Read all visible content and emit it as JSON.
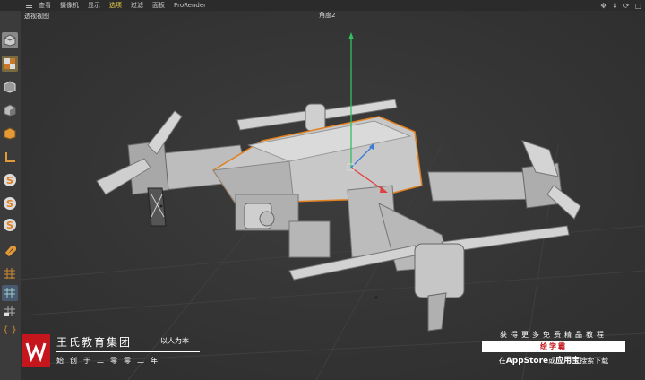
{
  "menubar": {
    "items": [
      {
        "label": "查看",
        "active": false
      },
      {
        "label": "摄像机",
        "active": false
      },
      {
        "label": "显示",
        "active": false
      },
      {
        "label": "选项",
        "active": true
      },
      {
        "label": "过滤",
        "active": false
      },
      {
        "label": "面板",
        "active": false
      },
      {
        "label": "ProRender",
        "active": false
      }
    ],
    "nav_icons": [
      "move-icon",
      "zoom-icon",
      "rotate-icon",
      "maximize-icon"
    ]
  },
  "viewport": {
    "view_name": "透视视图",
    "camera_label": "角度2"
  },
  "toolbar": {
    "tools": [
      "cube-icon",
      "checker-icon",
      "cube-outline-icon",
      "cube-solid-icon",
      "cube-orange-icon",
      "floor-icon",
      "spline-s-icon",
      "spline-s2-icon",
      "spline-s3-icon",
      "magnet-icon",
      "grid-icon",
      "grid-blue-icon",
      "grid-lock-icon",
      "bracket-icon"
    ]
  },
  "watermark": {
    "brand": "王氏教育集团",
    "motto": "以人为本",
    "founded": "始创于二零零二年"
  },
  "promo": {
    "line1": "获得更多免费精品教程",
    "badge": "绘学霸",
    "line3_pre": "在",
    "line3_app": "AppStore",
    "line3_mid": "或",
    "line3_app2": "应用宝",
    "line3_post": "搜索下载"
  },
  "colors": {
    "accent": "#f2d24b",
    "brand_red": "#c4161c",
    "viewport_bg": "#333333",
    "axis_x": "#e04040",
    "axis_y": "#30c060",
    "axis_z": "#3a7ad8",
    "selection": "#e67e22"
  }
}
